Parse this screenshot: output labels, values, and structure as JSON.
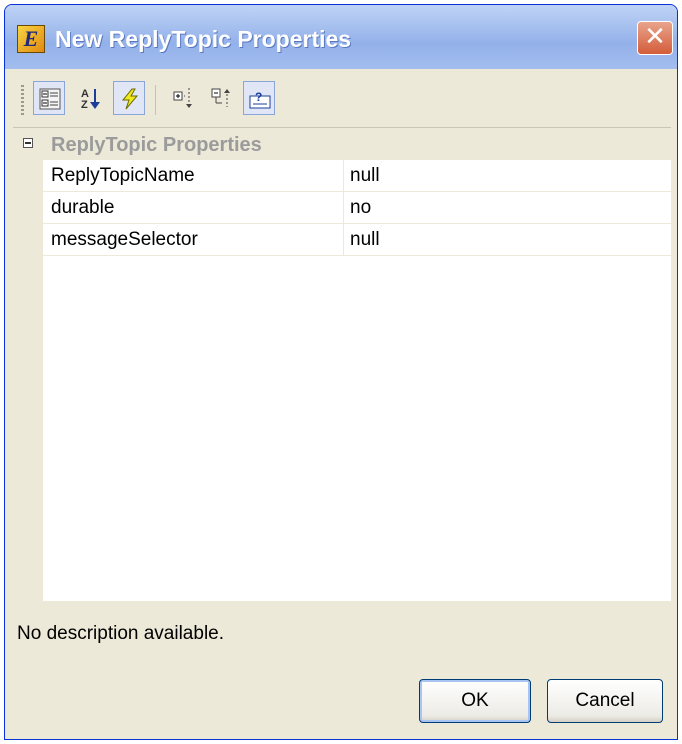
{
  "window": {
    "title": "New ReplyTopic Properties",
    "app_icon_letter": "E",
    "close_glyph": "✕"
  },
  "toolbar": {
    "buttons": [
      {
        "name": "categorized-view-icon",
        "active": true
      },
      {
        "name": "sort-alphabetical-icon",
        "active": false
      },
      {
        "name": "events-icon",
        "active": true
      },
      {
        "name": "expand-all-icon",
        "active": false
      },
      {
        "name": "collapse-all-icon",
        "active": false
      },
      {
        "name": "show-description-icon",
        "active": true
      }
    ]
  },
  "grid": {
    "category": "ReplyTopic Properties",
    "properties": [
      {
        "name": "ReplyTopicName",
        "value": "null"
      },
      {
        "name": "durable",
        "value": "no"
      },
      {
        "name": "messageSelector",
        "value": "null"
      }
    ]
  },
  "description": {
    "text": "No description available."
  },
  "buttons": {
    "ok_label": "OK",
    "cancel_label": "Cancel"
  },
  "colors": {
    "title_gradient": "#a9c2ef",
    "close_button": "#d35c3a",
    "dialog_background": "#ece9d8",
    "category_text": "#9b9b9b"
  }
}
